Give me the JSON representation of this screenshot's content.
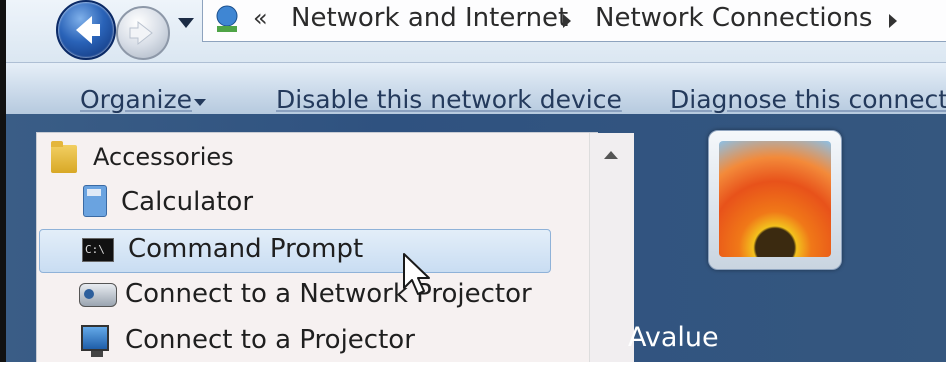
{
  "breadcrumb": {
    "prefix": "«",
    "items": [
      "Network and Internet",
      "Network Connections"
    ]
  },
  "toolbar": {
    "organize": "Organize",
    "disable": "Disable this network device",
    "diagnose": "Diagnose this connecti"
  },
  "programs": {
    "items": [
      {
        "label": "Accessories",
        "icon": "folder-icon"
      },
      {
        "label": "Calculator",
        "icon": "calculator-icon"
      },
      {
        "label": "Command Prompt",
        "icon": "command-prompt-icon",
        "icon_text": "C:\\",
        "selected": true
      },
      {
        "label": "Connect to a Network Projector",
        "icon": "network-projector-icon"
      },
      {
        "label": "Connect to a Projector",
        "icon": "projector-icon"
      }
    ]
  },
  "user": {
    "name": "Avalue"
  },
  "colors": {
    "start_menu_blue": "#2f5280",
    "selection": "#c9ddf2",
    "programs_bg": "#f6f1f1"
  }
}
